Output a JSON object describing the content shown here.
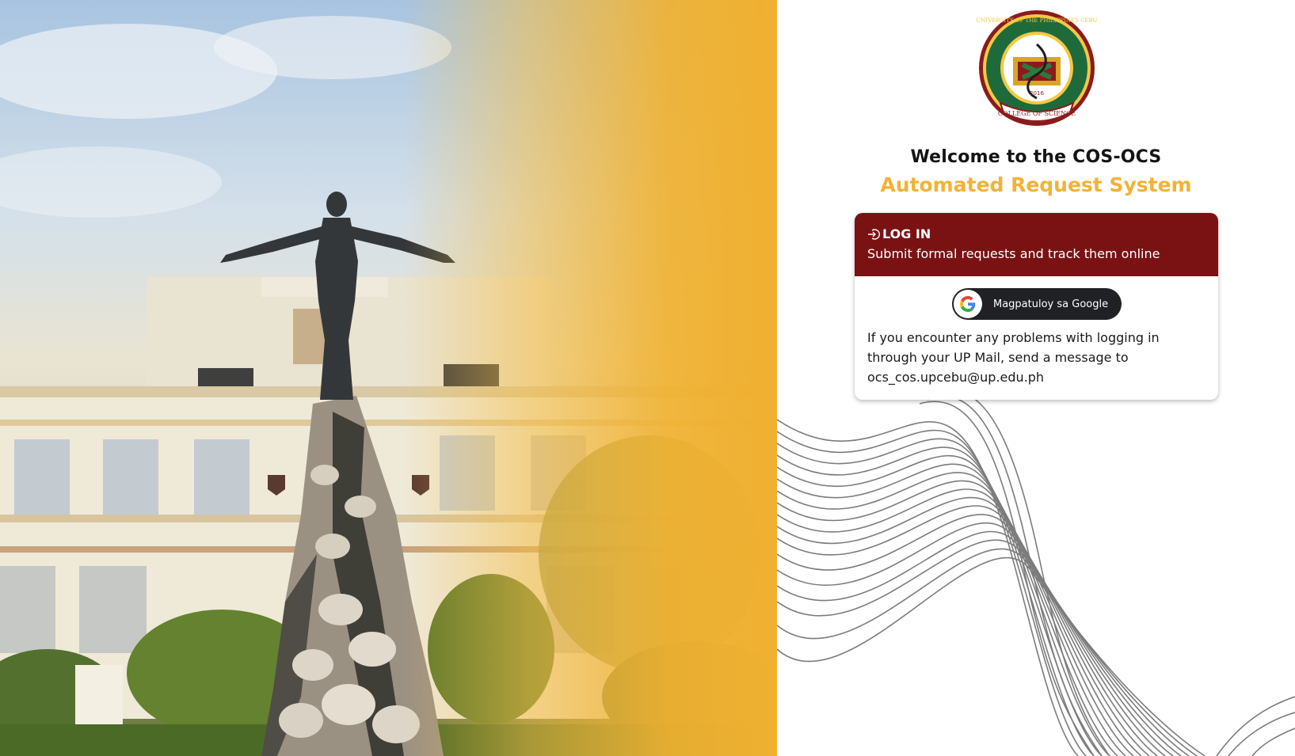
{
  "hero": {
    "image_alt": "Oblation statue in front of a campus building"
  },
  "seal": {
    "ring_text": "UNIVERSITY OF THE PHILIPPINES CEBU",
    "ribbon_text": "COLLEGE OF SCIENCE",
    "year": "2016"
  },
  "welcome": {
    "line1": "Welcome to the COS-OCS",
    "line2": "Automated Request System"
  },
  "login_card": {
    "title": "LOG IN",
    "description": "Submit formal requests and track them online",
    "google_button_label": "Magpatuloy sa Google",
    "help_text": "If you encounter any problems with logging in through your UP Mail, send a message to ocs_cos.upcebu@up.edu.ph"
  },
  "colors": {
    "maroon": "#7a1213",
    "gold": "#f3b234",
    "google_button": "#202124"
  },
  "icons": {
    "login": "login-icon",
    "google": "google-g-icon",
    "seal": "college-seal-icon"
  }
}
